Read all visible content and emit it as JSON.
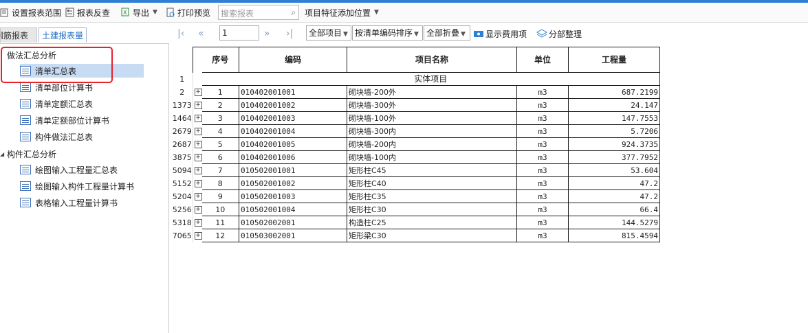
{
  "toolbar": {
    "set_range": "设置报表范围",
    "report_check": "报表反查",
    "export": "导出",
    "print_preview": "打印预览",
    "search_placeholder": "搜索报表",
    "add_position": "项目特征添加位置"
  },
  "left_tabs": {
    "steel": "钢筋报表量",
    "civil": "土建报表量"
  },
  "tree": {
    "group1": "做法汇总分析",
    "group1_items": [
      "清单汇总表",
      "清单部位计算书",
      "清单定额汇总表",
      "清单定额部位计算书",
      "构件做法汇总表"
    ],
    "group2": "构件汇总分析",
    "group2_items": [
      "绘图输入工程量汇总表",
      "绘图输入构件工程量计算书",
      "表格输入工程量计算书"
    ]
  },
  "nav": {
    "page": "1",
    "filter_all": "全部项目",
    "sort": "按清单编码排序",
    "fold": "全部折叠",
    "show_fee": "显示费用项",
    "arrange": "分部整理"
  },
  "table": {
    "headers": {
      "seq": "序号",
      "code": "编码",
      "name": "项目名称",
      "unit": "单位",
      "qty": "工程量"
    },
    "section_row_num": "1",
    "section_title": "实体项目",
    "rows": [
      {
        "rn": "2",
        "seq": "1",
        "code": "010402001001",
        "name": "砌块墙-200外",
        "unit": "m3",
        "qty": "687.2199"
      },
      {
        "rn": "1373",
        "seq": "2",
        "code": "010402001002",
        "name": "砌块墙-300外",
        "unit": "m3",
        "qty": "24.147"
      },
      {
        "rn": "1464",
        "seq": "3",
        "code": "010402001003",
        "name": "砌块墙-100外",
        "unit": "m3",
        "qty": "147.7553"
      },
      {
        "rn": "2679",
        "seq": "4",
        "code": "010402001004",
        "name": "砌块墙-300内",
        "unit": "m3",
        "qty": "5.7206"
      },
      {
        "rn": "2687",
        "seq": "5",
        "code": "010402001005",
        "name": "砌块墙-200内",
        "unit": "m3",
        "qty": "924.3735"
      },
      {
        "rn": "3875",
        "seq": "6",
        "code": "010402001006",
        "name": "砌块墙-100内",
        "unit": "m3",
        "qty": "377.7952"
      },
      {
        "rn": "5094",
        "seq": "7",
        "code": "010502001001",
        "name": "矩形柱C45",
        "unit": "m3",
        "qty": "53.604"
      },
      {
        "rn": "5152",
        "seq": "8",
        "code": "010502001002",
        "name": "矩形柱C40",
        "unit": "m3",
        "qty": "47.2"
      },
      {
        "rn": "5204",
        "seq": "9",
        "code": "010502001003",
        "name": "矩形柱C35",
        "unit": "m3",
        "qty": "47.2"
      },
      {
        "rn": "5256",
        "seq": "10",
        "code": "010502001004",
        "name": "矩形柱C30",
        "unit": "m3",
        "qty": "66.4"
      },
      {
        "rn": "5318",
        "seq": "11",
        "code": "010502002001",
        "name": "构造柱C25",
        "unit": "m3",
        "qty": "144.5279"
      },
      {
        "rn": "7065",
        "seq": "12",
        "code": "010503002001",
        "name": "矩形梁C30",
        "unit": "m3",
        "qty": "815.4594"
      }
    ]
  },
  "colors": {
    "accent": "#2f7fd4",
    "selection": "#c7dbf3",
    "highlight_box": "#e8212a"
  }
}
